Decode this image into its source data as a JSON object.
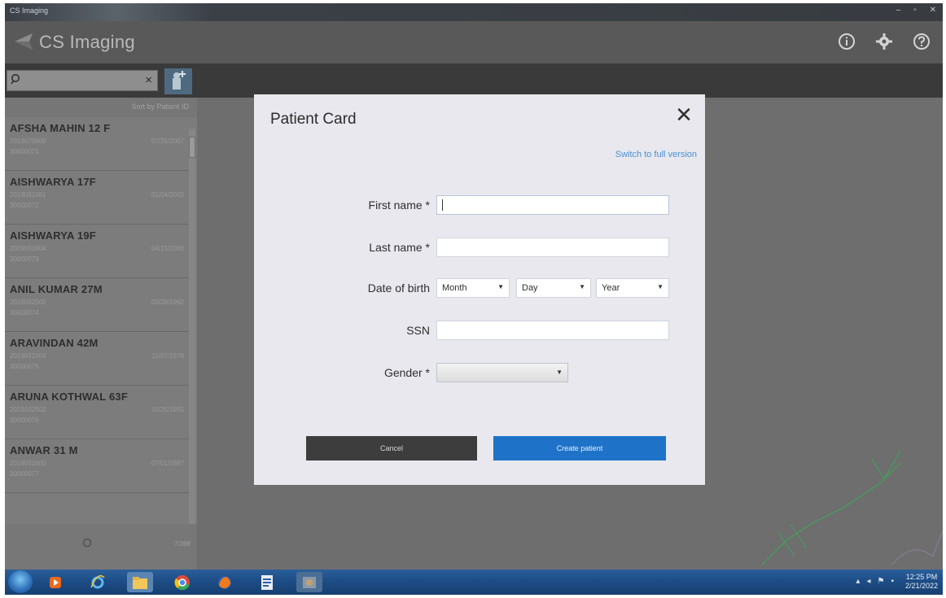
{
  "window": {
    "title": "CS Imaging",
    "controls": [
      "–",
      "▫",
      "✕"
    ]
  },
  "header": {
    "app_name": "CS Imaging",
    "icons": [
      "info-icon",
      "gear-icon",
      "help-icon"
    ]
  },
  "search": {
    "placeholder": "",
    "clear_glyph": "×"
  },
  "sidebar": {
    "sort_label": "Sort by Patient ID",
    "patients": [
      {
        "name": "AFSHA MAHIN 12 F",
        "number": "2019070800",
        "date": "07/25/2007",
        "id": "30000071"
      },
      {
        "name": "AISHWARYA 17F",
        "number": "2019031081",
        "date": "01/04/2002",
        "id": "30000072"
      },
      {
        "name": "AISHWARYA 19F",
        "number": "2019031804",
        "date": "04/15/2000",
        "id": "30000073"
      },
      {
        "name": "ANIL KUMAR 27M",
        "number": "2019032500",
        "date": "03/28/1992",
        "id": "30000074"
      },
      {
        "name": "ARAVINDAN 42M",
        "number": "2019031004",
        "date": "11/07/1976",
        "id": "30000075"
      },
      {
        "name": "ARUNA KOTHWAL 63F",
        "number": "2019102502",
        "date": "10/25/1955",
        "id": "30000076"
      },
      {
        "name": "ANWAR 31 M",
        "number": "2019031600",
        "date": "07/01/1987",
        "id": "30000077"
      }
    ],
    "footer_text": "7/398"
  },
  "modal": {
    "title": "Patient Card",
    "close_glyph": "✕",
    "switch_link": "Switch to full version",
    "fields": {
      "first_name_label": "First name *",
      "first_name_value": "",
      "last_name_label": "Last name *",
      "last_name_value": "",
      "dob_label": "Date of birth",
      "dob_month": "Month",
      "dob_day": "Day",
      "dob_year": "Year",
      "ssn_label": "SSN",
      "ssn_value": "",
      "gender_label": "Gender *",
      "gender_value": ""
    },
    "cancel_label": "Cancel",
    "create_label": "Create patient"
  },
  "taskbar": {
    "apps": [
      "start-button",
      "media-player-icon",
      "internet-explorer-icon",
      "file-explorer-icon",
      "chrome-icon",
      "firefox-icon",
      "word-icon",
      "cs-imaging-icon"
    ],
    "clock_time": "12:25 PM",
    "clock_date": "2/21/2022"
  },
  "colors": {
    "accent": "#1e73c8",
    "link": "#4a8fd4",
    "modal_bg": "#e8e8ee",
    "cancel_bg": "#3d3d3d"
  }
}
